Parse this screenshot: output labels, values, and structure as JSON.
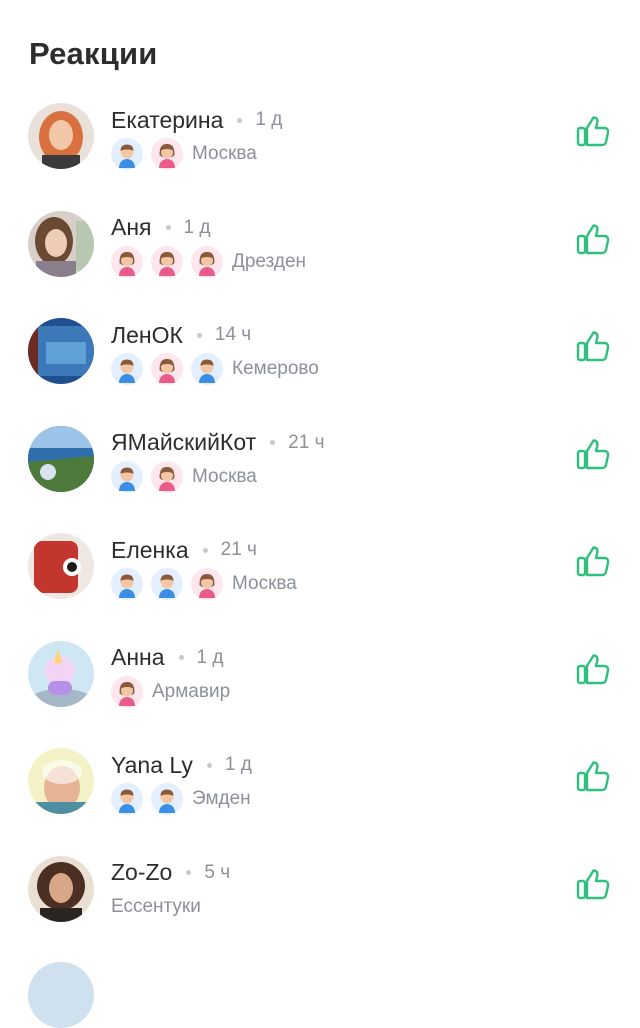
{
  "header": {
    "title": "Реакции"
  },
  "colors": {
    "like_accent": "#2fbf7e",
    "boy_bg": "#e3efff",
    "girl_bg": "#fde6ee"
  },
  "reactions": [
    {
      "name": "Екатерина",
      "time": "1 д",
      "city": "Москва",
      "kids": [
        "boy-icon",
        "girl-icon"
      ],
      "avatar": "avatar-redhead-woman"
    },
    {
      "name": "Аня",
      "time": "1 д",
      "city": "Дрезден",
      "kids": [
        "girl-icon",
        "girl-icon",
        "girl-icon"
      ],
      "avatar": "avatar-woman-brown-hair"
    },
    {
      "name": "ЛенОК",
      "time": "14 ч",
      "city": "Кемерово",
      "kids": [
        "boy-icon",
        "girl-icon",
        "boy-icon"
      ],
      "avatar": "avatar-blue-painting"
    },
    {
      "name": "ЯМайскийКот",
      "time": "21 ч",
      "city": "Москва",
      "kids": [
        "boy-icon",
        "girl-icon"
      ],
      "avatar": "avatar-sea-landscape"
    },
    {
      "name": "Еленка",
      "time": "21 ч",
      "city": "Москва",
      "kids": [
        "boy-icon",
        "boy-icon",
        "girl-icon"
      ],
      "avatar": "avatar-red-toy"
    },
    {
      "name": "Анна",
      "time": "1 д",
      "city": "Армавир",
      "kids": [
        "girl-icon"
      ],
      "avatar": "avatar-unicorn"
    },
    {
      "name": "Yana Ly",
      "time": "1 д",
      "city": "Эмден",
      "kids": [
        "boy-icon",
        "boy-icon"
      ],
      "avatar": "avatar-woman-glow"
    },
    {
      "name": "Zo-Zo",
      "time": "5 ч",
      "city": "Ессентуки",
      "kids": [],
      "avatar": "avatar-curly-woman"
    }
  ]
}
